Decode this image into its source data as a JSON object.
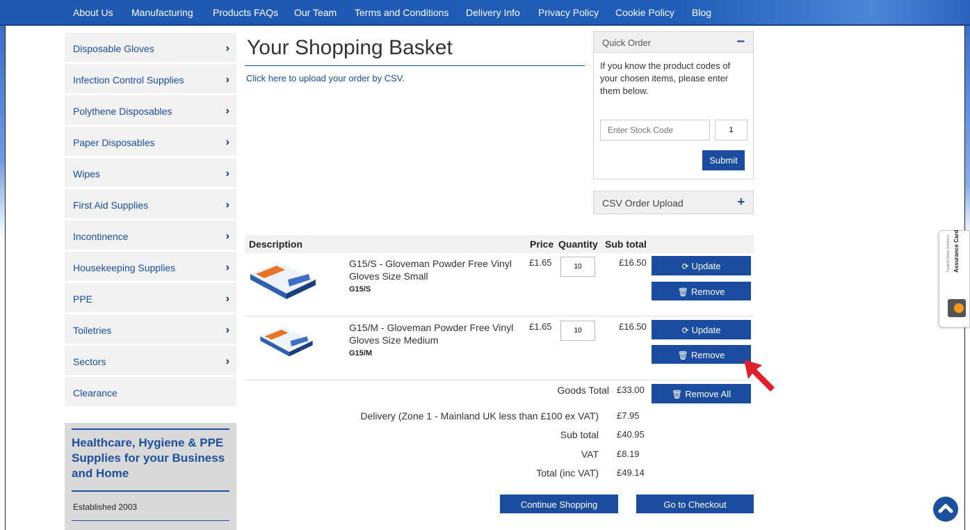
{
  "nav": [
    "About Us",
    "Manufacturing",
    "Products FAQs",
    "Our Team",
    "Terms and Conditions",
    "Delivery Info",
    "Privacy Policy",
    "Cookie Policy",
    "Blog"
  ],
  "sidebar": {
    "items": [
      "Disposable Gloves",
      "Infection Control Supplies",
      "Polythene Disposables",
      "Paper Disposables",
      "Wipes",
      "First Aid Supplies",
      "Incontinence",
      "Housekeeping Supplies",
      "PPE",
      "Toiletries",
      "Sectors",
      "Clearance"
    ],
    "chevron": "›",
    "promo_heading": "Healthcare, Hygiene & PPE Supplies for your Business and Home",
    "promo_established": "Established 2003"
  },
  "main": {
    "title": "Your Shopping Basket",
    "csv_link": "Click here to upload your order by CSV."
  },
  "quick_order": {
    "title": "Quick Order",
    "toggle": "−",
    "text": "If you know the product codes of your chosen items, please enter them below.",
    "code_placeholder": "Enter Stock Code",
    "qty_value": "1",
    "submit": "Submit"
  },
  "csv_upload": {
    "title": "CSV Order Upload",
    "toggle": "+"
  },
  "table": {
    "headers": {
      "description": "Description",
      "price": "Price",
      "quantity": "Quantity",
      "subtotal": "Sub total"
    },
    "rows": [
      {
        "name": "G15/S - Gloveman Powder Free Vinyl Gloves Size Small",
        "code": "G15/S",
        "price": "£1.65",
        "qty": "10",
        "subtotal": "£16.50",
        "update": "Update",
        "remove": "Remove"
      },
      {
        "name": "G15/M - Gloveman Powder Free Vinyl Gloves Size Medium",
        "code": "G15/M",
        "price": "£1.65",
        "qty": "10",
        "subtotal": "£16.50",
        "update": "Update",
        "remove": "Remove"
      }
    ]
  },
  "totals": {
    "goods_total_label": "Goods Total",
    "goods_total": "£33.00",
    "remove_all": "Remove All",
    "delivery_label": "Delivery (Zone 1 - Mainland UK less than £100 ex VAT)",
    "delivery": "£7.95",
    "subtotal_label": "Sub total",
    "subtotal": "£40.95",
    "vat_label": "VAT",
    "vat": "£8.19",
    "total_label": "Total (inc VAT)",
    "total": "£49.14"
  },
  "actions": {
    "continue": "Continue Shopping",
    "checkout": "Go to Checkout"
  },
  "assurance": {
    "label": "Assurance Card",
    "sublabel": "Trusted Global Solutions"
  },
  "colors": {
    "brand_blue": "#1a4da0",
    "nav_blue": "#1f5db8",
    "arrow_red": "#e0202a"
  }
}
